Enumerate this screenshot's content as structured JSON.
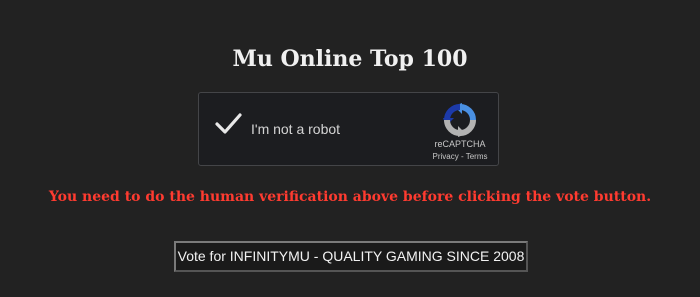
{
  "page": {
    "title": "Mu Online Top 100"
  },
  "captcha": {
    "label": "I'm not a robot",
    "brand": "reCAPTCHA",
    "privacy_label": "Privacy",
    "separator": "-",
    "terms_label": "Terms",
    "checked": true,
    "check_icon": "checkmark-icon",
    "logo_icon": "recaptcha-logo-icon",
    "colors": {
      "check": "#e8e8e8",
      "logo_blue": "#4a90e2",
      "logo_dark_blue": "#1c3aa9",
      "logo_gray": "#b2b2b2"
    }
  },
  "warning": {
    "text": "You need to do the human verification above before clicking the vote button.",
    "color": "#ff3b30"
  },
  "vote": {
    "label": "Vote for INFINITYMU - QUALITY GAMING SINCE 2008"
  }
}
